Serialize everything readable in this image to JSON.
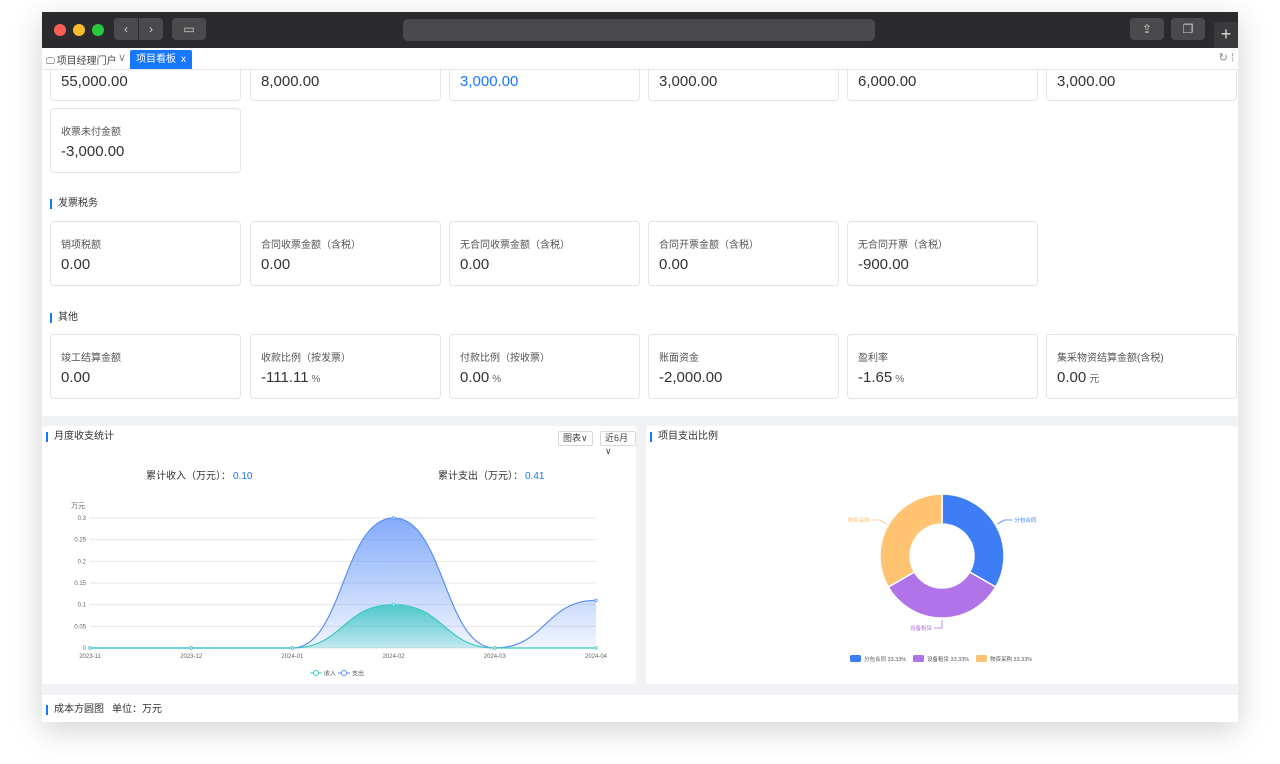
{
  "browser": {
    "plus": "+"
  },
  "tabs": {
    "home": "项目经理门户",
    "active": "项目看板",
    "close": "x"
  },
  "top_row": [
    "55,000.00",
    "8,000.00",
    "3,000.00",
    "3,000.00",
    "6,000.00",
    "3,000.00"
  ],
  "row2": {
    "label": "收票未付金额",
    "value": "-3,000.00"
  },
  "section_tax": "发票税务",
  "tax_cards": [
    {
      "label": "销项税额",
      "value": "0.00"
    },
    {
      "label": "合同收票金额（含税）",
      "value": "0.00"
    },
    {
      "label": "无合同收票金额（含税）",
      "value": "0.00"
    },
    {
      "label": "合同开票金额（含税）",
      "value": "0.00"
    },
    {
      "label": "无合同开票（含税）",
      "value": "-900.00"
    }
  ],
  "section_other": "其他",
  "other_cards": [
    {
      "label": "竣工结算金额",
      "value": "0.00",
      "unit": ""
    },
    {
      "label": "收款比例（按发票）",
      "value": "-111.11",
      "unit": "%"
    },
    {
      "label": "付款比例（按收票）",
      "value": "0.00",
      "unit": "%"
    },
    {
      "label": "账面资金",
      "value": "-2,000.00",
      "unit": ""
    },
    {
      "label": "盈利率",
      "value": "-1.65",
      "unit": "%"
    },
    {
      "label": "集采物资结算金额(含税)",
      "value": "0.00",
      "unit": "元"
    }
  ],
  "monthly": {
    "title": "月度收支统计",
    "select_type": "图表",
    "select_range": "近6月",
    "income_label": "累计收入（万元）：",
    "income_value": "0.10",
    "expense_label": "累计支出（万元）：",
    "expense_value": "0.41"
  },
  "expense_ratio": {
    "title": "项目支出比例"
  },
  "bottom": {
    "title": "成本方圆图",
    "unit": "单位：万元"
  },
  "colors": {
    "accent": "#1677ff",
    "income": "#3cc7c2",
    "expense": "#5b8ff9",
    "pie1": "#3d7ef7",
    "pie2": "#b073e8",
    "pie3": "#ffc372"
  },
  "chart_data": [
    {
      "type": "area",
      "ylabel": "万元",
      "ylim": [
        0,
        0.3
      ],
      "yticks": [
        "0",
        "0.05",
        "0.1",
        "0.15",
        "0.2",
        "0.25",
        "0.3"
      ],
      "categories": [
        "2023-11",
        "2023-12",
        "2024-01",
        "2024-02",
        "2024-03",
        "2024-04"
      ],
      "series": [
        {
          "name": "收入",
          "values": [
            0,
            0,
            0,
            0.1,
            0,
            0
          ]
        },
        {
          "name": "支出",
          "values": [
            0,
            0,
            0,
            0.3,
            0,
            0.11
          ]
        }
      ],
      "legend": "bottom-center"
    },
    {
      "type": "pie",
      "donut": true,
      "slices": [
        {
          "name": "分包合同",
          "percent": "33.33%",
          "value": 33.33
        },
        {
          "name": "设备租赁",
          "percent": "33.33%",
          "value": 33.33
        },
        {
          "name": "物资采购",
          "percent": "33.33%",
          "value": 33.33
        }
      ],
      "legend": "bottom-center"
    }
  ]
}
